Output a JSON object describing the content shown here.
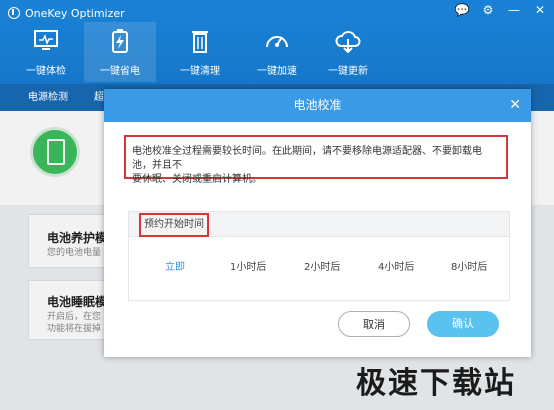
{
  "app": {
    "title": "OneKey Optimizer"
  },
  "window_controls": [
    {
      "icon": "chat-icon",
      "glyph": "💬"
    },
    {
      "icon": "gear-icon",
      "glyph": "⚙"
    },
    {
      "icon": "minimize-icon",
      "glyph": "—"
    },
    {
      "icon": "close-icon",
      "glyph": "✕"
    }
  ],
  "nav": {
    "items": [
      {
        "label": "一键体检",
        "icon": "monitor-icon",
        "active": false
      },
      {
        "label": "一键省电",
        "icon": "battery-charge-icon",
        "active": true
      },
      {
        "label": "一键清理",
        "icon": "trash-icon",
        "active": false
      },
      {
        "label": "一键加速",
        "icon": "speedometer-icon",
        "active": false
      },
      {
        "label": "一键更新",
        "icon": "cloud-download-icon",
        "active": false
      }
    ]
  },
  "subtabs": [
    "电源检测",
    "超"
  ],
  "cards": [
    {
      "title": "电池养护模",
      "desc": "您的电池电量"
    },
    {
      "title": "电池睡眠模",
      "desc1": "开启后，在您",
      "desc2": "功能将在拔掉"
    }
  ],
  "dialog": {
    "title": "电池校准",
    "close": "✕",
    "notice_line1": "电池校准全过程需要较长时间。在此期间，请不要移除电源适配器、不要卸载电池，并且不",
    "notice_line2": "要休眠、关闭或重启计算机。",
    "schedule_label": "预约开始时间",
    "options": [
      "立即",
      "1小时后",
      "2小时后",
      "4小时后",
      "8小时后"
    ],
    "selected_option": "立即",
    "cancel_label": "取消",
    "ok_label": "确认"
  },
  "watermark": "极速下载站",
  "colors": {
    "header": "#1a82d6",
    "subtab_bar": "#1766ad",
    "dialog_header": "#3a9ae6",
    "highlight": "#d6353b",
    "confirm": "#5ac2ef",
    "selected": "#2f8fe8",
    "battery": "#3fbf5f"
  }
}
